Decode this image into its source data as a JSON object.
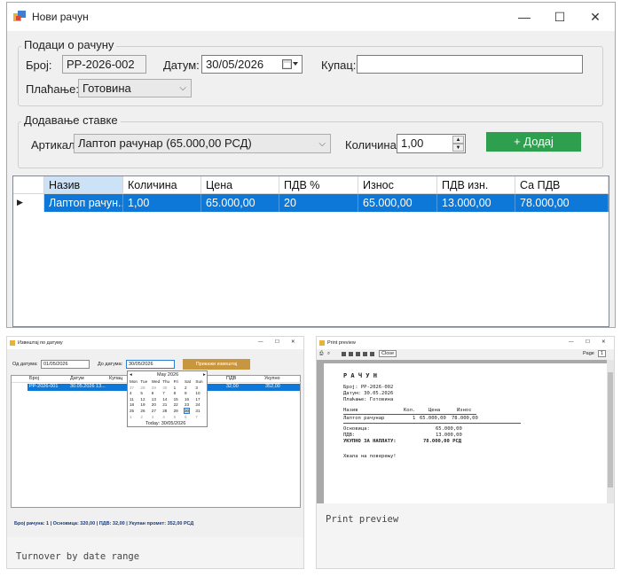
{
  "main_window": {
    "title": "Нови рачун",
    "controls": {
      "minimize": "—",
      "maximize": "☐",
      "close": "✕"
    },
    "invoice_group": {
      "legend": "Подаци о рачуну",
      "number_label": "Број:",
      "number_value": "РР-2026-002",
      "date_label": "Датум:",
      "date_value": "30/05/2026",
      "buyer_label": "Купац:",
      "buyer_value": "",
      "payment_label": "Плаћање:",
      "payment_value": "Готовина"
    },
    "item_group": {
      "legend": "Додавање ставке",
      "article_label": "Артикал:",
      "article_value": "Лаптоп рачунар (65.000,00 РСД)",
      "qty_label": "Количина:",
      "qty_value": "1,00",
      "add_button": "+ Додај",
      "add_color": "#2e9e4f"
    },
    "grid": {
      "columns": [
        "Назив",
        "Количина",
        "Цена",
        "ПДВ %",
        "Износ",
        "ПДВ изн.",
        "Са ПДВ"
      ],
      "rows": [
        [
          "Лаптоп рачун...",
          "1,00",
          "65.000,00",
          "20",
          "65.000,00",
          "13.000,00",
          "78.000,00"
        ]
      ],
      "selection_color": "#0d78d7"
    }
  },
  "turnover_thumb": {
    "caption": "Turnover by date range",
    "title": "Извештај по датуму",
    "from_label": "Од датума:",
    "from_value": "01/05/2026",
    "to_label": "До датума:",
    "to_value": "30/05/2026",
    "show_button": "Прикажи извештај",
    "columns": [
      "Број",
      "Датум",
      "Купац",
      "",
      "",
      "ПДВ",
      "Укупно"
    ],
    "row": [
      "РР-2026-001",
      "30.05.2026 13...",
      "",
      "",
      "",
      "32,00",
      "352,00"
    ],
    "calendar": {
      "month": "May 2026",
      "weekdays": [
        "Mon",
        "Tue",
        "Wed",
        "Thu",
        "Fri",
        "Sat",
        "Sun"
      ],
      "weeks": [
        [
          "27",
          "28",
          "29",
          "30",
          "1",
          "2",
          "3"
        ],
        [
          "4",
          "5",
          "6",
          "7",
          "8",
          "9",
          "10"
        ],
        [
          "11",
          "12",
          "13",
          "14",
          "15",
          "16",
          "17"
        ],
        [
          "18",
          "19",
          "20",
          "21",
          "22",
          "23",
          "24"
        ],
        [
          "25",
          "26",
          "27",
          "28",
          "29",
          "30",
          "31"
        ],
        [
          "1",
          "2",
          "3",
          "4",
          "5",
          "6",
          "7"
        ]
      ],
      "today": "Today: 30/05/2026"
    },
    "status": "Број рачуна: 1   |   Основица: 320,00   |   ПДВ: 32,00   |   Укупан промет: 352,00 РСД"
  },
  "preview_thumb": {
    "caption": "Print preview",
    "title": "Print preview",
    "close_label": "Close",
    "page_label": "Page",
    "page_value": "1",
    "doc": {
      "heading": "Р А Ч У Н",
      "lines": [
        "Број: РР-2026-002",
        "Датум: 30.05.2026",
        "Плаћање: Готовина"
      ],
      "table_header": [
        "Назив",
        "Кол.",
        "Цена",
        "Износ"
      ],
      "table_row": [
        "Лаптоп рачунар",
        "1",
        "65.000,00",
        "78.000,00"
      ],
      "base_label": "Основица:",
      "base_value": "65.000,00",
      "vat_label": "ПДВ:",
      "vat_value": "13.000,00",
      "total_label": "УКУПНО ЗА НАПЛАТУ:",
      "total_value": "78.000,00 РСД",
      "thanks": "Хвала на поверењу!"
    }
  }
}
